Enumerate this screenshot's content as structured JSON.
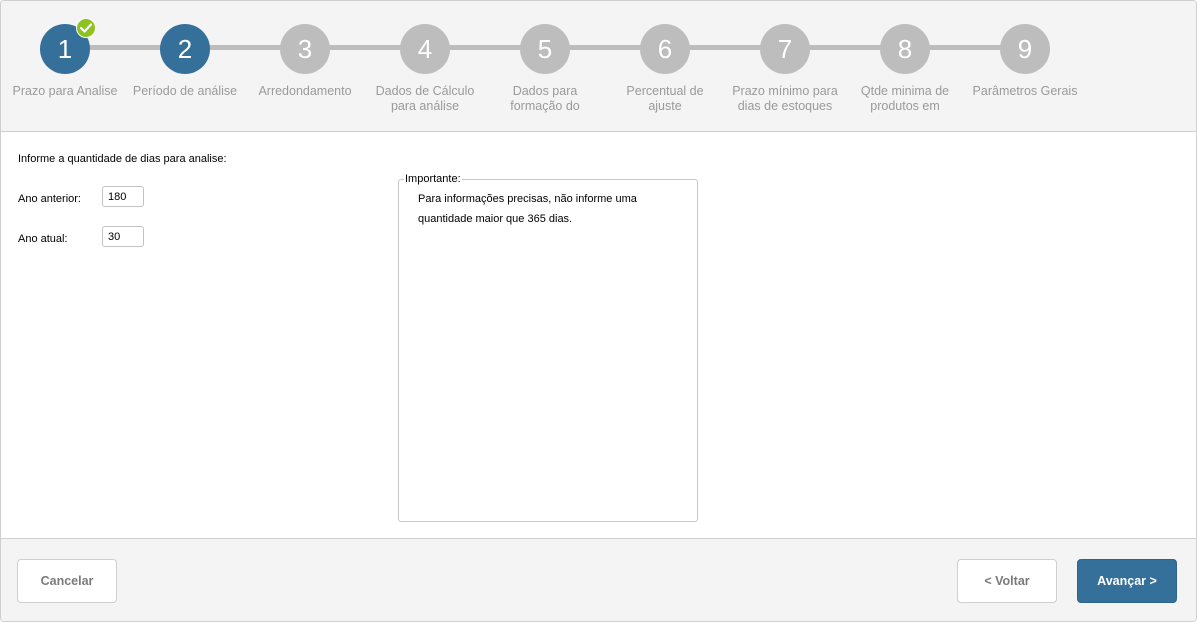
{
  "wizard": {
    "steps": [
      {
        "number": "1",
        "label": "Prazo para Analise",
        "state": "completed",
        "badge_icon": "check-icon"
      },
      {
        "number": "2",
        "label": "Período de análise",
        "state": "active"
      },
      {
        "number": "3",
        "label": "Arredondamento",
        "state": "pending"
      },
      {
        "number": "4",
        "label": "Dados de Cálculo para análise",
        "state": "pending"
      },
      {
        "number": "5",
        "label": "Dados para formação do estoque",
        "state": "pending"
      },
      {
        "number": "6",
        "label": "Percentual de ajuste",
        "state": "pending"
      },
      {
        "number": "7",
        "label": "Prazo mínimo para dias de estoques",
        "state": "pending"
      },
      {
        "number": "8",
        "label": "Qtde minima de produtos em estoques",
        "state": "pending"
      },
      {
        "number": "9",
        "label": "Parâmetros Gerais",
        "state": "pending"
      }
    ],
    "colors": {
      "active": "#35709b",
      "pending": "#bdbdbd",
      "check": "#8dc21f"
    }
  },
  "form": {
    "prompt": "Informe a quantidade de dias para analise:",
    "previous_year_label": "Ano anterior:",
    "previous_year_value": "180",
    "current_year_label": "Ano atual:",
    "current_year_value": "30"
  },
  "info_box": {
    "legend": "Importante:",
    "text": "Para informações precisas, não informe uma quantidade maior que 365 dias."
  },
  "footer": {
    "cancel_label": "Cancelar",
    "back_label": "< Voltar",
    "next_label": "Avançar >"
  }
}
